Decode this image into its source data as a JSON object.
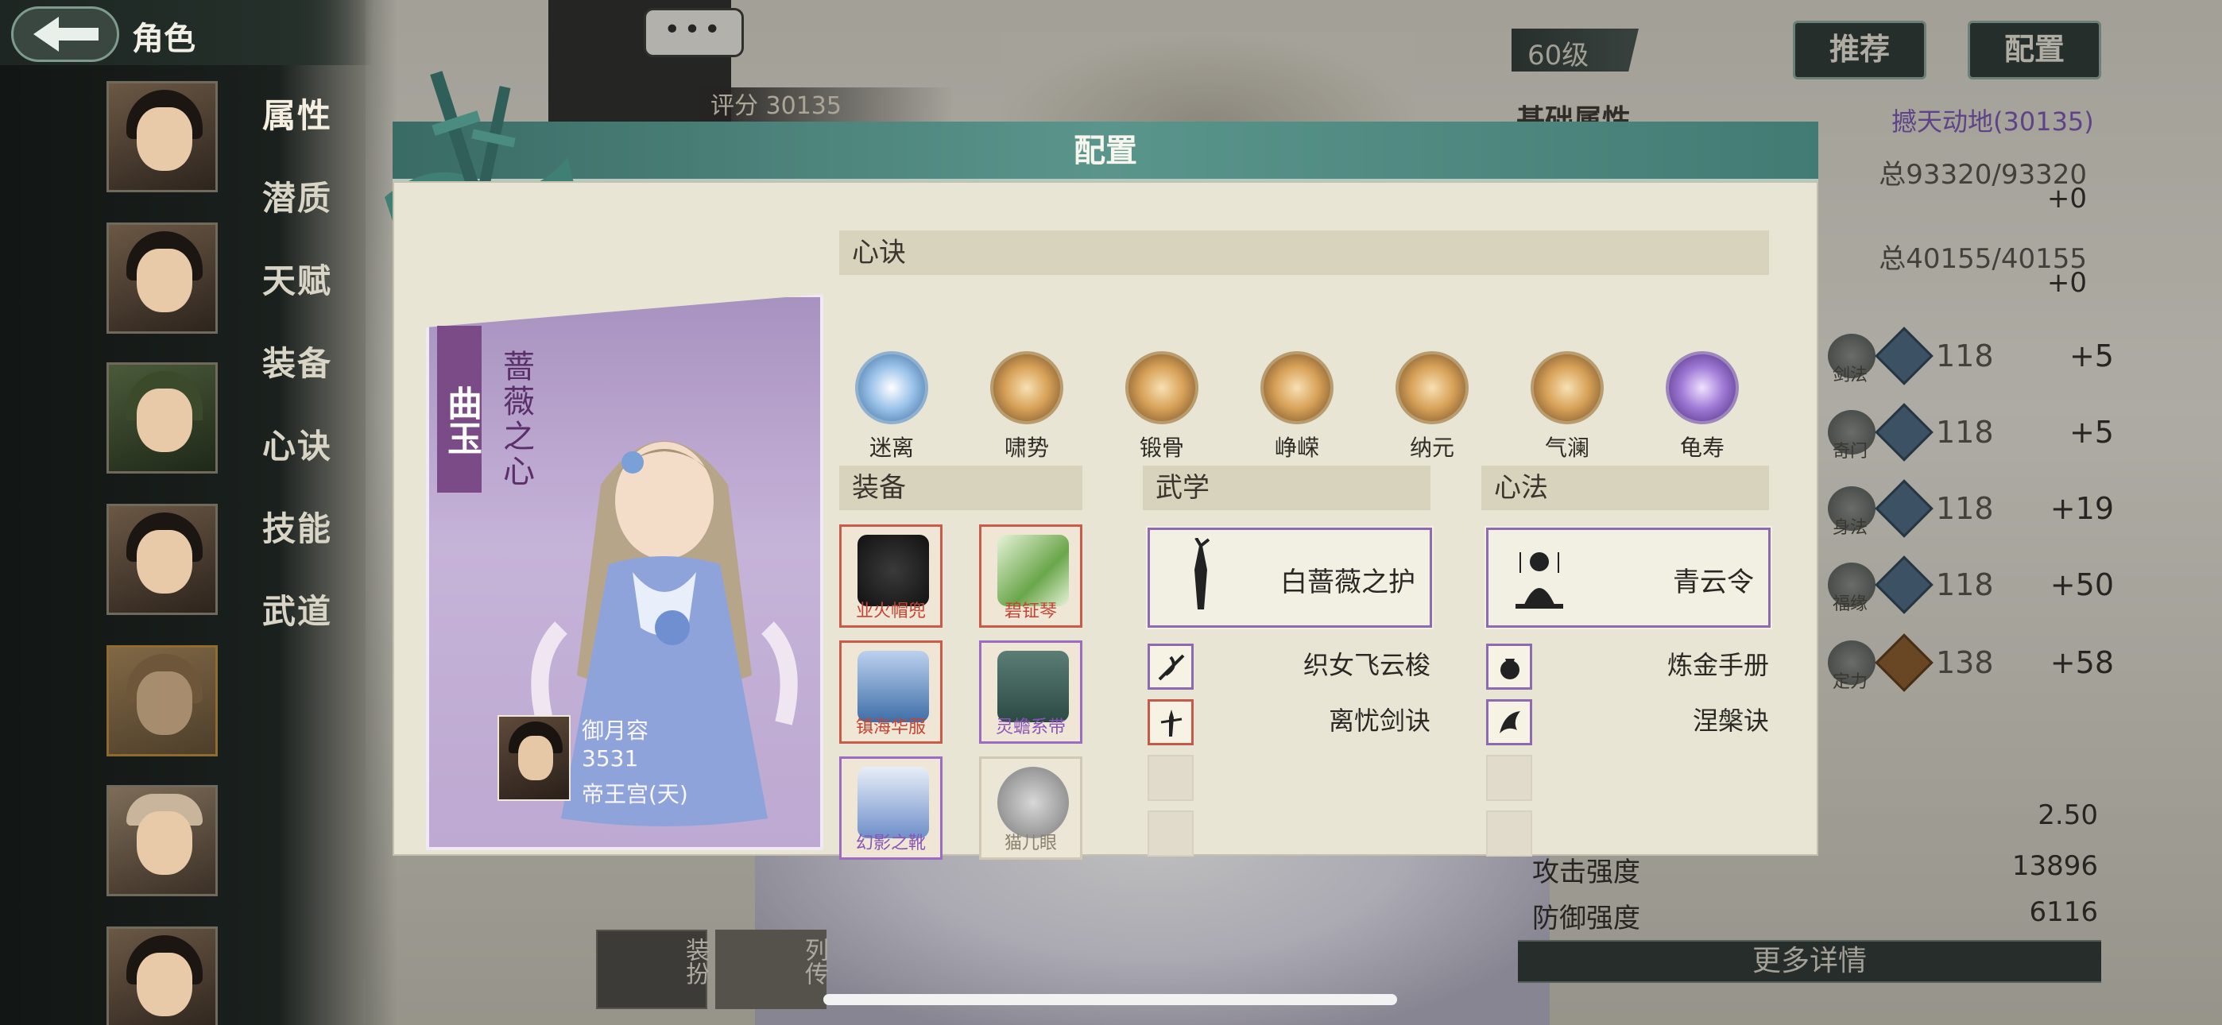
{
  "header": {
    "title": "角色"
  },
  "side_nav": [
    "属性",
    "潜质",
    "天赋",
    "装备",
    "心诀",
    "技能",
    "武道"
  ],
  "top_right": {
    "level": "60级",
    "recommend_label": "推荐",
    "config_label": "配置"
  },
  "background_panel": {
    "dots": "•••",
    "score_label": "评分",
    "score_value": "30135",
    "base_attr_label": "基础属性",
    "power_title": "撼天动地(30135)",
    "total1": "总93320/93320",
    "plus1": "+0",
    "total2": "总40155/40155",
    "plus2": "+0",
    "stats": [
      {
        "label": "剑法",
        "value": "118",
        "bonus": "+5"
      },
      {
        "label": "奇门",
        "value": "118",
        "bonus": "+5"
      },
      {
        "label": "身法",
        "value": "118",
        "bonus": "+19"
      },
      {
        "label": "福缘",
        "value": "118",
        "bonus": "+50"
      },
      {
        "label": "定力",
        "value": "138",
        "bonus": "+58"
      }
    ],
    "bottom_stats": [
      {
        "label": "",
        "value": "2.50"
      },
      {
        "label": "攻击强度",
        "value": "13896"
      },
      {
        "label": "防御强度",
        "value": "6116"
      }
    ],
    "more_label": "更多详情",
    "tab_dress": "装扮",
    "tab_bio": "列传"
  },
  "modal": {
    "title": "配置",
    "card": {
      "name": "曲玉",
      "subtitle": "蔷薇之心",
      "owner_name": "御月容",
      "owner_power": "3531",
      "owner_server": "帝王宫(天)"
    },
    "xinjue": {
      "header": "心诀",
      "items": [
        "迷离",
        "啸势",
        "锻骨",
        "峥嵘",
        "纳元",
        "气澜",
        "龟寿"
      ]
    },
    "equipment": {
      "header": "装备",
      "items": [
        "业火帽兜",
        "碧钲琴",
        "镇海华服",
        "灵蟾系带",
        "幻影之靴",
        "猫儿眼"
      ]
    },
    "wuxue": {
      "header": "武学",
      "main": "白蔷薇之护",
      "skills": [
        "织女飞云梭",
        "离忧剑诀"
      ]
    },
    "xinfa": {
      "header": "心法",
      "main": "青云令",
      "skills": [
        "炼金手册",
        "涅槃诀"
      ]
    }
  },
  "colors": {
    "accent_teal": "#5a958c",
    "rare_purple": "#8c6bb0",
    "rare_red": "#c95b4b"
  }
}
